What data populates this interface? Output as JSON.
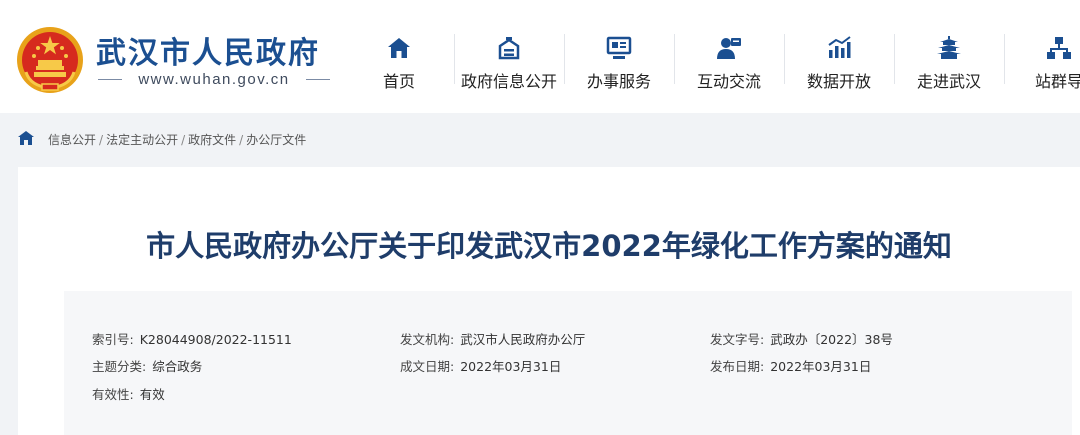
{
  "header": {
    "site_title": "武汉市人民政府",
    "site_url": "www.wuhan.gov.cn",
    "nav": [
      {
        "label": "首页",
        "icon": "home-icon"
      },
      {
        "label": "政府信息公开",
        "icon": "info-disclosure-icon"
      },
      {
        "label": "办事服务",
        "icon": "service-icon"
      },
      {
        "label": "互动交流",
        "icon": "interaction-icon"
      },
      {
        "label": "数据开放",
        "icon": "data-chart-icon"
      },
      {
        "label": "走进武汉",
        "icon": "landmark-icon"
      },
      {
        "label": "站群导",
        "icon": "site-cluster-icon"
      }
    ]
  },
  "breadcrumb": {
    "items": [
      "信息公开",
      "法定主动公开",
      "政府文件",
      "办公厅文件"
    ],
    "separator": "/"
  },
  "document": {
    "title": "市人民政府办公厅关于印发武汉市2022年绿化工作方案的通知",
    "meta": {
      "index_no": {
        "label": "索引号:",
        "value": "K28044908/2022-11511"
      },
      "issuing_agency": {
        "label": "发文机构:",
        "value": "武汉市人民政府办公厅"
      },
      "doc_number": {
        "label": "发文字号:",
        "value": "武政办〔2022〕38号"
      },
      "category": {
        "label": "主题分类:",
        "value": "综合政务"
      },
      "written_date": {
        "label": "成文日期:",
        "value": "2022年03月31日"
      },
      "publish_date": {
        "label": "发布日期:",
        "value": "2022年03月31日"
      },
      "validity": {
        "label": "有效性:",
        "value": "有效"
      }
    }
  },
  "colors": {
    "brand_blue": "#1b4f91",
    "title_blue": "#1f3d6a",
    "page_bg": "#f1f3f6",
    "meta_bg": "#f6f7f9"
  }
}
